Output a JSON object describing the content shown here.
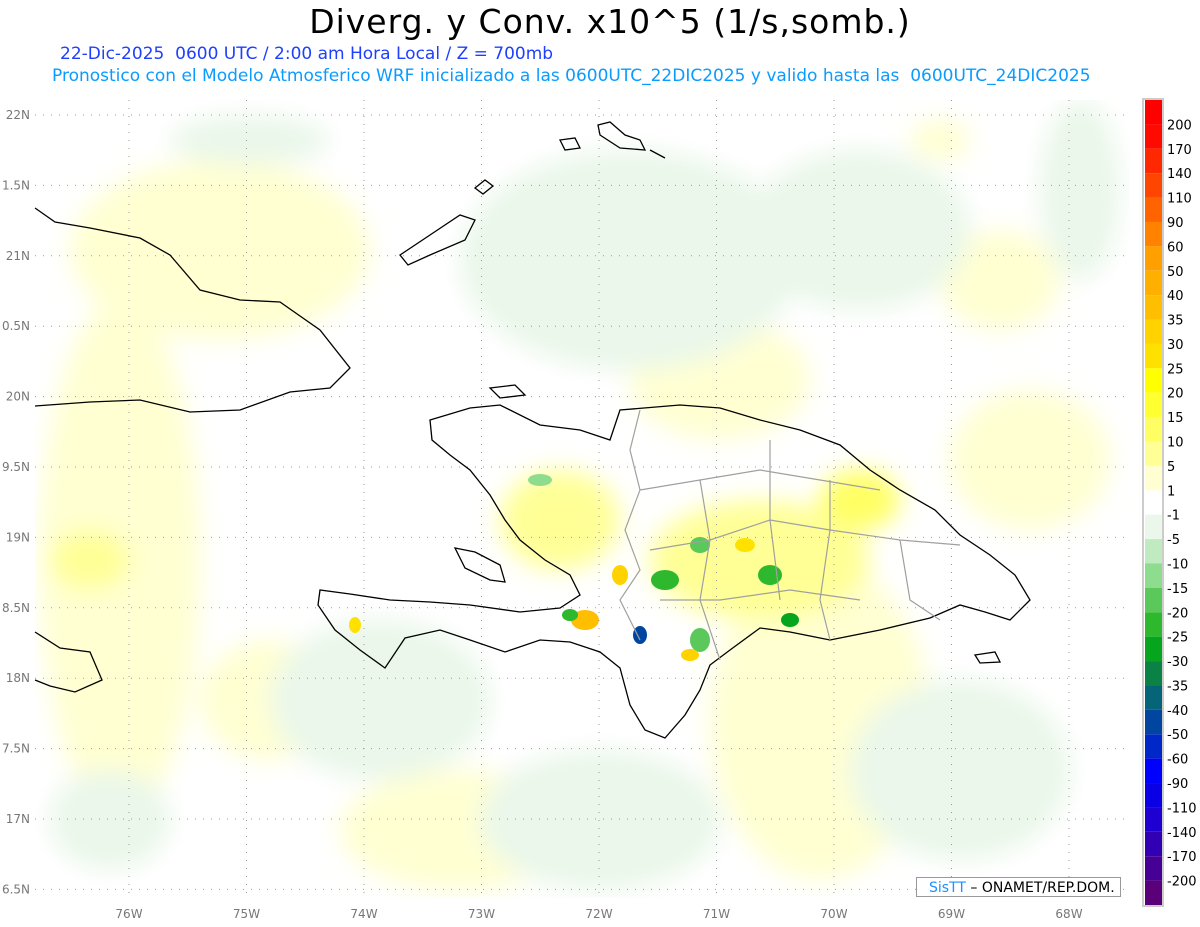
{
  "header": {
    "title": "Diverg. y Conv. x10^5 (1/s,somb.)",
    "subtitle": "22-Dic-2025  0600 UTC / 2:00 am Hora Local / Z = 700mb",
    "model_line": "Pronostico con el Modelo Atmosferico WRF inicializado a las 0600UTC_22DIC2025 y valido hasta las  0600UTC_24DIC2025"
  },
  "map": {
    "lon_labels": [
      "76W",
      "75W",
      "74W",
      "73W",
      "72W",
      "71W",
      "70W",
      "69W",
      "68W"
    ],
    "lat_labels": [
      "22N",
      "1.5N",
      "21N",
      "0.5N",
      "20N",
      "9.5N",
      "19N",
      "8.5N",
      "18N",
      "7.5N",
      "17N",
      "6.5N"
    ],
    "colors": {
      "coast": "#000000",
      "borders": "#a0a0a0",
      "grid": "#999999",
      "weak_div": "#ffffd2",
      "weak_conv": "#eaf7ea"
    }
  },
  "colorbar": {
    "labels": [
      "200",
      "170",
      "140",
      "110",
      "90",
      "60",
      "50",
      "40",
      "35",
      "30",
      "25",
      "20",
      "15",
      "10",
      "5",
      "1",
      "-1",
      "-5",
      "-10",
      "-15",
      "-20",
      "-25",
      "-30",
      "-35",
      "-40",
      "-50",
      "-60",
      "-90",
      "-110",
      "-140",
      "-170",
      "-200"
    ],
    "colors": [
      "#ff0000",
      "#ff0a00",
      "#ff2800",
      "#ff4600",
      "#ff6400",
      "#ff8200",
      "#ffa000",
      "#ffaf00",
      "#ffbe00",
      "#ffd200",
      "#ffe100",
      "#ffff00",
      "#ffff32",
      "#ffff64",
      "#ffff96",
      "#ffffd2",
      "#ffffff",
      "#eaf7ea",
      "#c0eac0",
      "#8edc8e",
      "#5ac85a",
      "#2db82d",
      "#05a51e",
      "#0a8246",
      "#066478",
      "#0046a0",
      "#0028c8",
      "#0000ff",
      "#0a00e6",
      "#1e00d2",
      "#3200b4",
      "#460096",
      "#5a0078"
    ]
  },
  "credit": {
    "brand": "SisTT",
    "text": " – ONAMET/REP.DOM."
  }
}
